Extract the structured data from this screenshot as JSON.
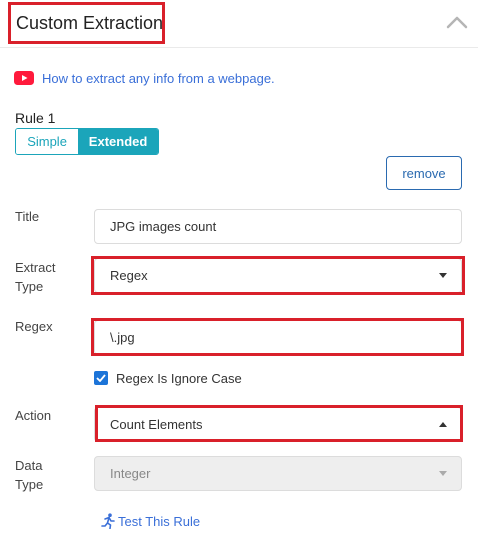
{
  "header": {
    "title": "Custom Extraction",
    "collapse_icon": "chevron-up-icon"
  },
  "video_link": {
    "icon": "youtube-icon",
    "text": "How to extract any info from a webpage."
  },
  "rule": {
    "label": "Rule 1",
    "mode_tabs": [
      {
        "label": "Simple",
        "selected": false
      },
      {
        "label": "Extended",
        "selected": true
      }
    ],
    "remove_label": "remove"
  },
  "form": {
    "title_label": "Title",
    "title_value": "JPG images count",
    "extract_type_label_line1": "Extract",
    "extract_type_label_line2": "Type",
    "extract_type_value": "Regex",
    "regex_label": "Regex",
    "regex_value": "\\.jpg",
    "ignore_case_label": "Regex Is Ignore Case",
    "ignore_case_checked": true,
    "action_label": "Action",
    "action_value": "Count Elements",
    "data_type_label_line1": "Data",
    "data_type_label_line2": "Type",
    "data_type_value": "Integer",
    "test_rule_label": "Test This Rule"
  },
  "colors": {
    "accent": "#1ba5ba",
    "link": "#3a6fd8",
    "highlight": "#d9202a",
    "checkbox": "#1c74d8"
  }
}
